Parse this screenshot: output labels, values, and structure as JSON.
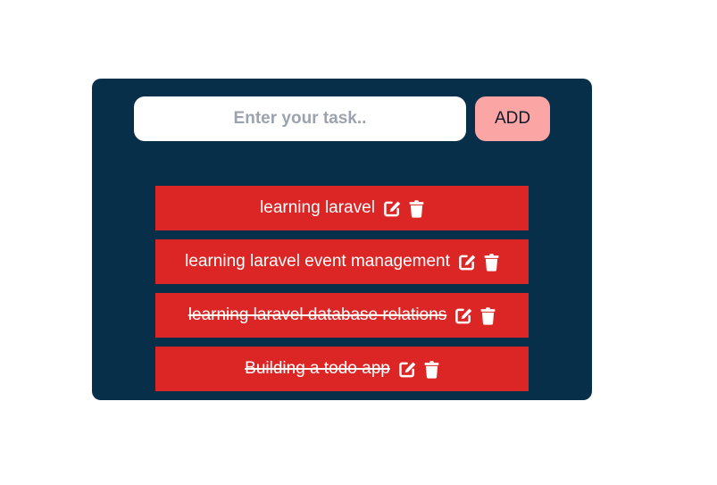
{
  "form": {
    "input_value": "",
    "input_placeholder": "Enter your task..",
    "add_label": "ADD"
  },
  "todos": [
    {
      "text": "learning laravel",
      "completed": false
    },
    {
      "text": "learning laravel event management",
      "completed": false
    },
    {
      "text": "learning laravel database relations",
      "completed": true
    },
    {
      "text": "Building a todo app",
      "completed": true
    }
  ],
  "icons": {
    "edit": "edit-icon",
    "delete": "trash-icon"
  },
  "colors": {
    "card_background": "#082f49",
    "add_button": "#fca5a5",
    "todo_item": "#dc2626",
    "text_on_item": "#ffffff",
    "placeholder": "#9ca3af"
  }
}
